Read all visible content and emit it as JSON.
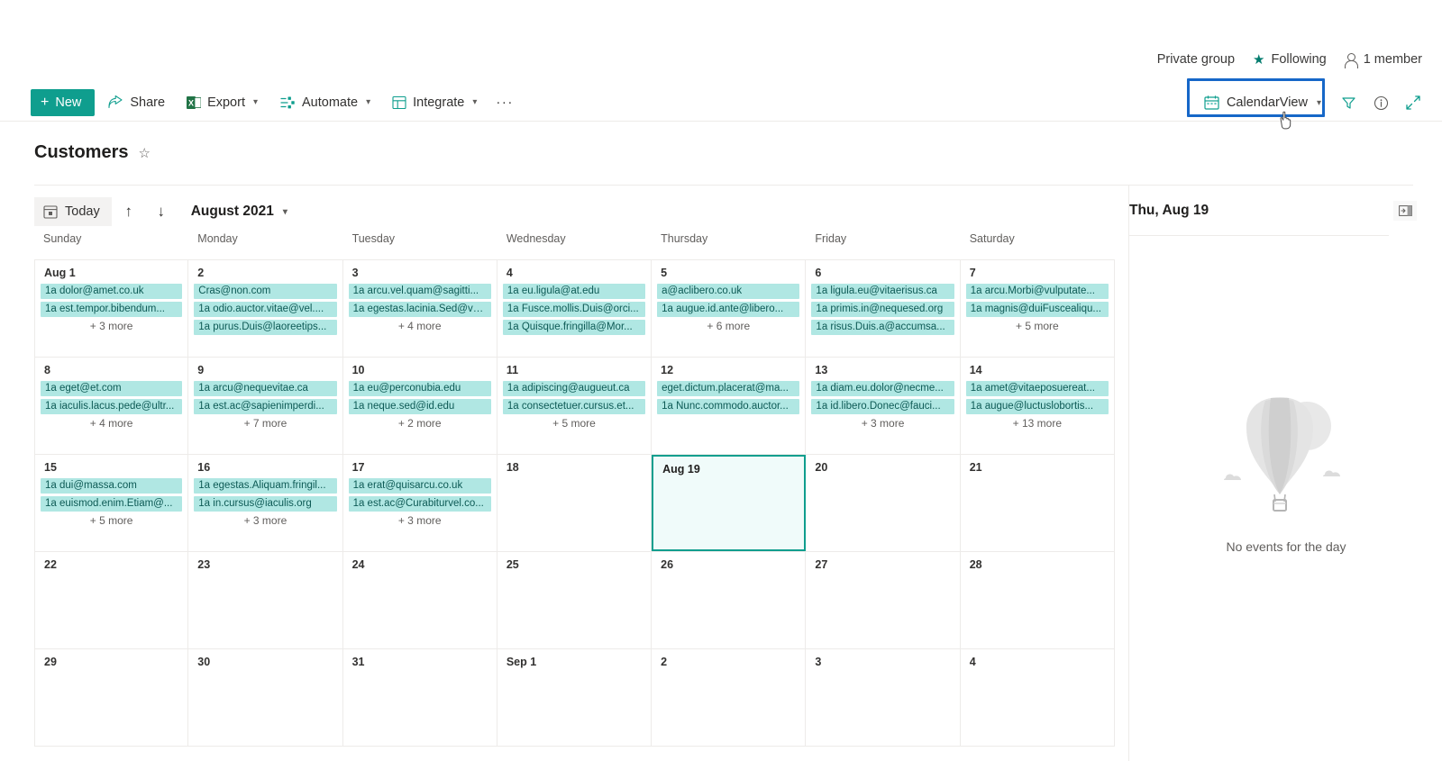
{
  "site": {
    "privacy_label": "Private group",
    "following_label": "Following",
    "members_label": "1 member"
  },
  "commandbar": {
    "new_label": "New",
    "share_label": "Share",
    "export_label": "Export",
    "automate_label": "Automate",
    "integrate_label": "Integrate",
    "overflow_label": "···",
    "view_label": "CalendarView"
  },
  "header": {
    "title": "Customers"
  },
  "calendar_toolbar": {
    "today_label": "Today",
    "up_arrow": "↑",
    "down_arrow": "↓",
    "month_label": "August 2021"
  },
  "calendar": {
    "weekday_headers": [
      "Sunday",
      "Monday",
      "Tuesday",
      "Wednesday",
      "Thursday",
      "Friday",
      "Saturday"
    ],
    "selected_day": "Aug 19",
    "weeks": [
      [
        {
          "daynum": "Aug 1",
          "events": [
            "1a dolor@amet.co.uk",
            "1a est.tempor.bibendum..."
          ],
          "more": "+ 3 more",
          "selected": false
        },
        {
          "daynum": "2",
          "events": [
            "Cras@non.com",
            "1a odio.auctor.vitae@vel....",
            "1a purus.Duis@laoreetips..."
          ],
          "more": "",
          "selected": false
        },
        {
          "daynum": "3",
          "events": [
            "1a arcu.vel.quam@sagitti...",
            "1a egestas.lacinia.Sed@ve..."
          ],
          "more": "+ 4 more",
          "selected": false
        },
        {
          "daynum": "4",
          "events": [
            "1a eu.ligula@at.edu",
            "1a Fusce.mollis.Duis@orci...",
            "1a Quisque.fringilla@Mor..."
          ],
          "more": "",
          "selected": false
        },
        {
          "daynum": "5",
          "events": [
            "a@aclibero.co.uk",
            "1a augue.id.ante@libero..."
          ],
          "more": "+ 6 more",
          "selected": false
        },
        {
          "daynum": "6",
          "events": [
            "1a ligula.eu@vitaerisus.ca",
            "1a primis.in@nequesed.org",
            "1a risus.Duis.a@accumsa..."
          ],
          "more": "",
          "selected": false
        },
        {
          "daynum": "7",
          "events": [
            "1a arcu.Morbi@vulputate...",
            "1a magnis@duiFuscealiqu..."
          ],
          "more": "+ 5 more",
          "selected": false
        }
      ],
      [
        {
          "daynum": "8",
          "events": [
            "1a eget@et.com",
            "1a iaculis.lacus.pede@ultr..."
          ],
          "more": "+ 4 more",
          "selected": false
        },
        {
          "daynum": "9",
          "events": [
            "1a arcu@nequevitae.ca",
            "1a est.ac@sapienimperdi..."
          ],
          "more": "+ 7 more",
          "selected": false
        },
        {
          "daynum": "10",
          "events": [
            "1a eu@perconubia.edu",
            "1a neque.sed@id.edu"
          ],
          "more": "+ 2 more",
          "selected": false
        },
        {
          "daynum": "11",
          "events": [
            "1a adipiscing@augueut.ca",
            "1a consectetuer.cursus.et..."
          ],
          "more": "+ 5 more",
          "selected": false
        },
        {
          "daynum": "12",
          "events": [
            "eget.dictum.placerat@ma...",
            "1a Nunc.commodo.auctor..."
          ],
          "more": "",
          "selected": false
        },
        {
          "daynum": "13",
          "events": [
            "1a diam.eu.dolor@necme...",
            "1a id.libero.Donec@fauci..."
          ],
          "more": "+ 3 more",
          "selected": false
        },
        {
          "daynum": "14",
          "events": [
            "1a amet@vitaeposuereat...",
            "1a augue@luctuslobortis..."
          ],
          "more": "+ 13 more",
          "selected": false
        }
      ],
      [
        {
          "daynum": "15",
          "events": [
            "1a dui@massa.com",
            "1a euismod.enim.Etiam@..."
          ],
          "more": "+ 5 more",
          "selected": false
        },
        {
          "daynum": "16",
          "events": [
            "1a egestas.Aliquam.fringil...",
            "1a in.cursus@iaculis.org"
          ],
          "more": "+ 3 more",
          "selected": false
        },
        {
          "daynum": "17",
          "events": [
            "1a erat@quisarcu.co.uk",
            "1a est.ac@Curabiturvel.co..."
          ],
          "more": "+ 3 more",
          "selected": false
        },
        {
          "daynum": "18",
          "events": [],
          "more": "",
          "selected": false
        },
        {
          "daynum": "Aug 19",
          "events": [],
          "more": "",
          "selected": true
        },
        {
          "daynum": "20",
          "events": [],
          "more": "",
          "selected": false
        },
        {
          "daynum": "21",
          "events": [],
          "more": "",
          "selected": false
        }
      ],
      [
        {
          "daynum": "22",
          "events": [],
          "more": "",
          "selected": false
        },
        {
          "daynum": "23",
          "events": [],
          "more": "",
          "selected": false
        },
        {
          "daynum": "24",
          "events": [],
          "more": "",
          "selected": false
        },
        {
          "daynum": "25",
          "events": [],
          "more": "",
          "selected": false
        },
        {
          "daynum": "26",
          "events": [],
          "more": "",
          "selected": false
        },
        {
          "daynum": "27",
          "events": [],
          "more": "",
          "selected": false
        },
        {
          "daynum": "28",
          "events": [],
          "more": "",
          "selected": false
        }
      ],
      [
        {
          "daynum": "29",
          "events": [],
          "more": "",
          "selected": false
        },
        {
          "daynum": "30",
          "events": [],
          "more": "",
          "selected": false
        },
        {
          "daynum": "31",
          "events": [],
          "more": "",
          "selected": false
        },
        {
          "daynum": "Sep 1",
          "events": [],
          "more": "",
          "selected": false
        },
        {
          "daynum": "2",
          "events": [],
          "more": "",
          "selected": false
        },
        {
          "daynum": "3",
          "events": [],
          "more": "",
          "selected": false
        },
        {
          "daynum": "4",
          "events": [],
          "more": "",
          "selected": false
        }
      ]
    ]
  },
  "details_panel": {
    "date_label": "Thu, Aug 19",
    "empty_text": "No events for the day"
  },
  "colors": {
    "accent_teal": "#0f9e8e",
    "chip_bg": "#b0e7e3",
    "chip_text": "#0d5a55",
    "highlight_blue": "#1667c8",
    "excel_green": "#217346"
  }
}
